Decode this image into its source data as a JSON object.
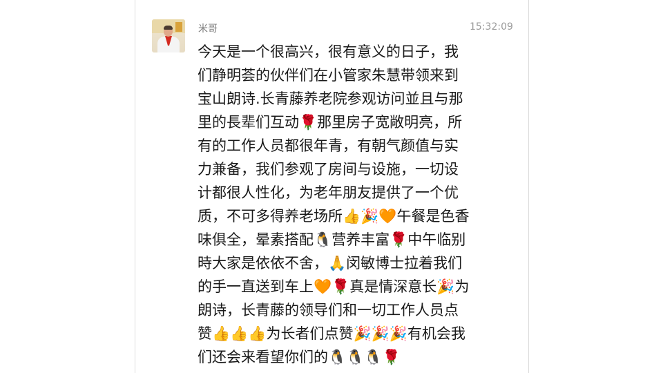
{
  "message": {
    "sender": "米哥",
    "timestamp": "15:32:09",
    "lines": [
      "今天是一个很高兴，很有意义的日子，我",
      "们静明荟的伙伴们在小管家朱慧带领来到",
      "宝山朗诗.长青藤养老院参观访问並且与那",
      "里的長辈们互动🌹那里房子宽敞明亮，所",
      "有的工作人员都很年青，有朝气颜值与实",
      "力兼备，我们参观了房间与设施，一切设",
      "计都很人性化，为老年朋友提供了一个优",
      "质，不可多得养老场所👍🎉🧡午餐是色香",
      "味俱全，晕素搭配🐧营养丰富🌹中午临别",
      "時大家是依依不舍，🙏闵敏博士拉着我们",
      "的手一直送到车上🧡🌹真是情深意长🎉为",
      "朗诗，长青藤的领导们和一切工作人员点",
      "赞👍👍👍为长者们点赞🎉🎉🎉有机会我",
      "们还会来看望你们的🐧🐧🐧🌹"
    ]
  }
}
